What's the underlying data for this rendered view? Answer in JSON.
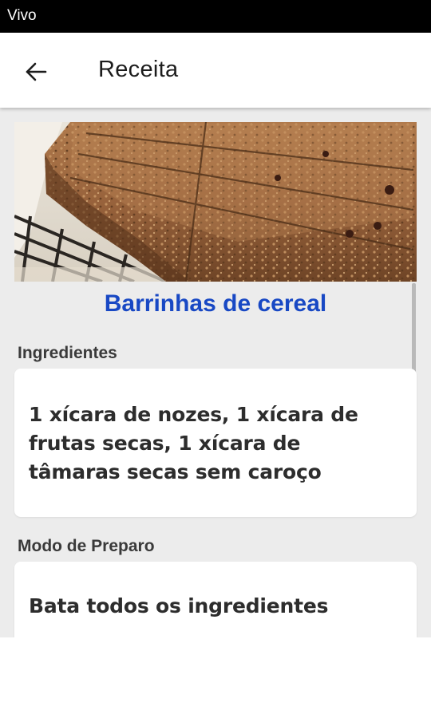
{
  "status_bar": {
    "carrier": "Vivo"
  },
  "app_bar": {
    "title": "Receita",
    "back_icon": "arrow-back-icon"
  },
  "recipe": {
    "title": "Barrinhas de cereal",
    "image": "cereal-bars-photo",
    "ingredients_label": "Ingredientes",
    "ingredients_text": "1 xícara de nozes, 1 xícara de frutas secas, 1 xícara de tâmaras secas sem caroço",
    "preparation_label": "Modo de Preparo",
    "preparation_text": "Bata todos os ingredientes"
  },
  "colors": {
    "title_blue": "#1848c4",
    "content_bg": "#ececec",
    "status_bar_bg": "#000000"
  }
}
